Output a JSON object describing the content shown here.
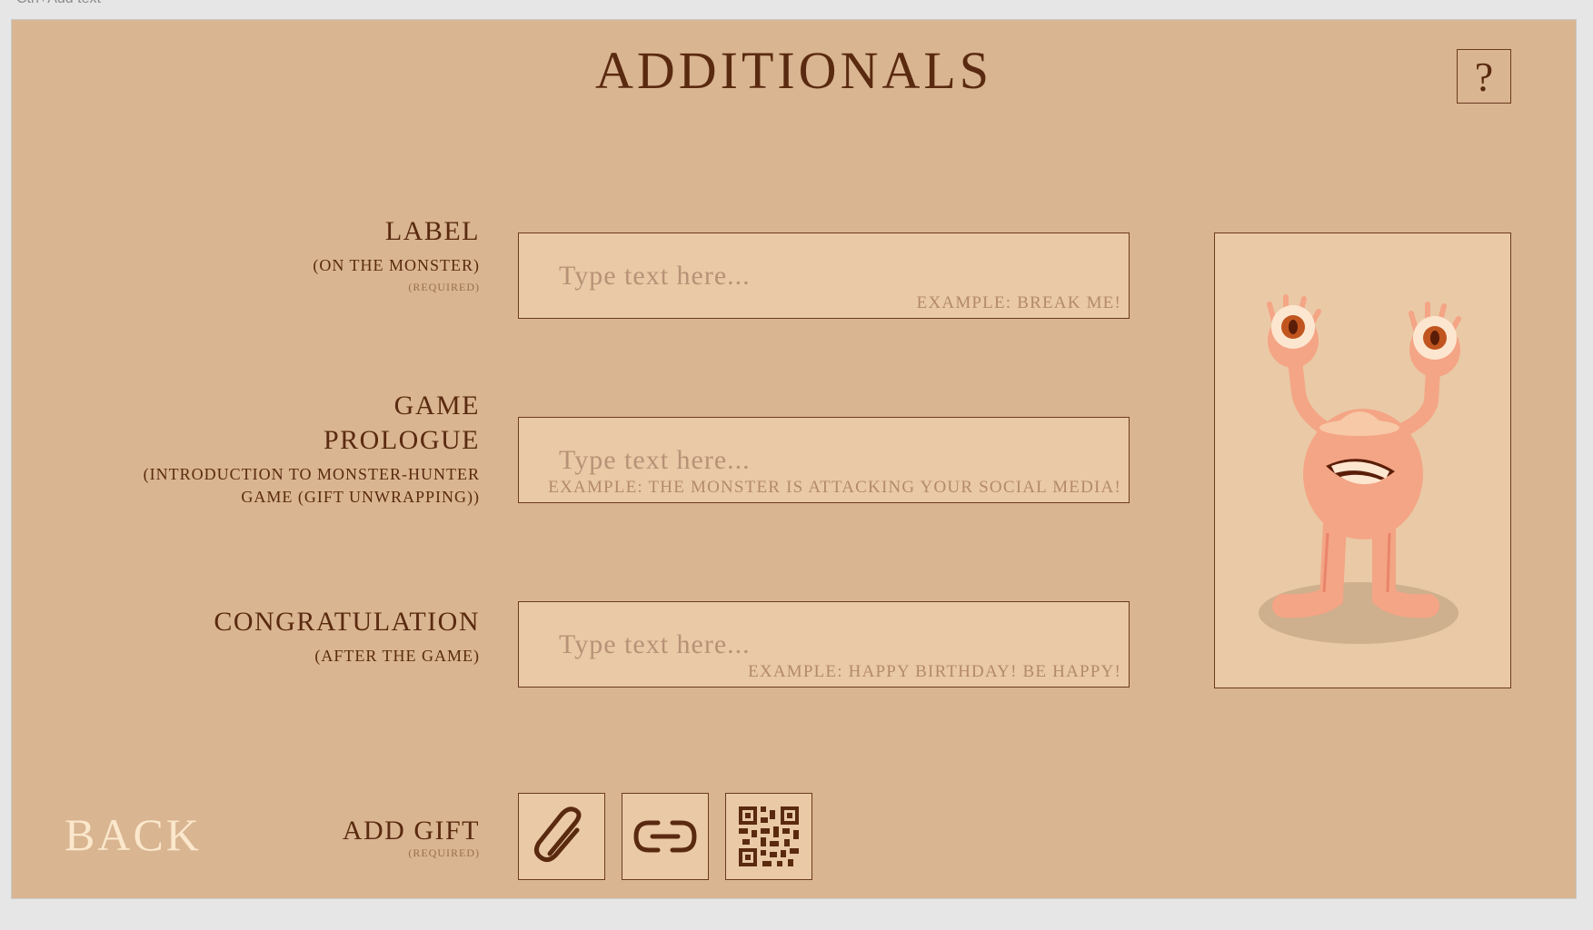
{
  "top_hint": "Ctrl+Add text",
  "header": {
    "title": "ADDITIONALS",
    "help_label": "?"
  },
  "fields": [
    {
      "title": "LABEL",
      "subtitle": "(ON THE MONSTER)",
      "required": "(REQUIRED)",
      "placeholder": "Type text here...",
      "example": "example: Break me!"
    },
    {
      "title": "GAME PROLOGUE",
      "subtitle": "(INTRODUCTION TO MONSTER-HUNTER GAME (GIFT UNWRAPPING))",
      "placeholder": "Type text here...",
      "example": "example: The monster is attacking your social media!"
    },
    {
      "title": "CONGRATULATION",
      "subtitle": "(AFTER THE GAME)",
      "placeholder": "Type text here...",
      "example": "example: Happy birthday! Be happy!"
    }
  ],
  "gift": {
    "label": "ADD GIFT",
    "required": "(REQUIRED)",
    "buttons": [
      {
        "icon": "paperclip-icon"
      },
      {
        "icon": "link-icon"
      },
      {
        "icon": "qr-code-icon"
      }
    ]
  },
  "back_label": "BACK",
  "colors": {
    "background": "#d9b591",
    "field_bg": "#eac9a6",
    "ink": "#5a2a10",
    "back_text": "#fbe8cc",
    "monster_skin": "#f5a98a"
  }
}
